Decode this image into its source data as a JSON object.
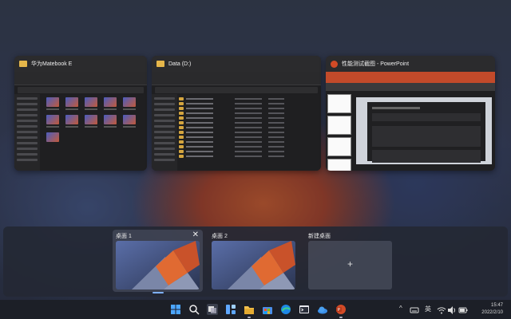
{
  "windows": [
    {
      "title": "华为Matebook E",
      "app": "file-explorer"
    },
    {
      "title": "Data (D:)",
      "app": "file-explorer"
    },
    {
      "title": "性能测试截图 - PowerPoint",
      "app": "powerpoint"
    }
  ],
  "desktops": [
    {
      "label": "桌面 1",
      "active": true
    },
    {
      "label": "桌面 2",
      "active": false
    },
    {
      "label": "新建桌面"
    }
  ],
  "new_desktop_plus": "+",
  "desktop_close": "✕",
  "taskbar": {
    "apps": [
      "windows-start",
      "search",
      "task-view",
      "widgets",
      "file-explorer",
      "microsoft-store",
      "edge",
      "terminal",
      "onedrive",
      "powerpoint"
    ],
    "tray": {
      "chevron": "^",
      "ime": "英"
    },
    "time": "15:47",
    "date": "2022/2/10"
  },
  "colors": {
    "accent": "#7fb0ff",
    "folder": "#d4a53f",
    "ppt": "#c24a2a"
  }
}
